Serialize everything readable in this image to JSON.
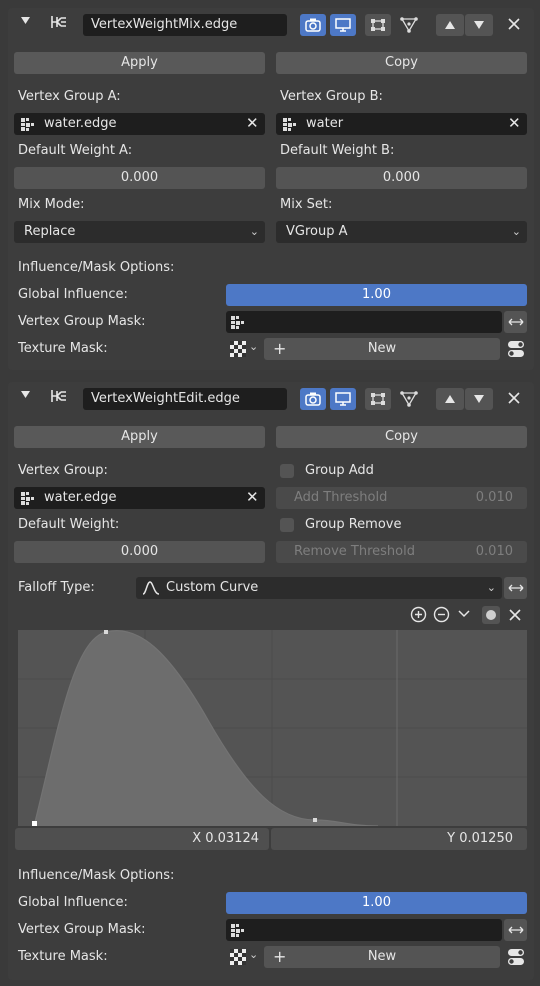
{
  "mix": {
    "name": "VertexWeightMix.edge",
    "apply": "Apply",
    "copy": "Copy",
    "vgroup_a_label": "Vertex Group A:",
    "vgroup_a_value": "water.edge",
    "vgroup_b_label": "Vertex Group B:",
    "vgroup_b_value": "water",
    "def_a_label": "Default Weight A:",
    "def_a_value": "0.000",
    "def_b_label": "Default Weight B:",
    "def_b_value": "0.000",
    "mix_mode_label": "Mix Mode:",
    "mix_mode_value": "Replace",
    "mix_set_label": "Mix Set:",
    "mix_set_value": "VGroup A",
    "influence_label": "Influence/Mask Options:",
    "global_influence_label": "Global Influence:",
    "global_influence_value": "1.00",
    "vgroup_mask_label": "Vertex Group Mask:",
    "texture_mask_label": "Texture Mask:",
    "new_label": "New"
  },
  "edit": {
    "name": "VertexWeightEdit.edge",
    "apply": "Apply",
    "copy": "Copy",
    "vgroup_label": "Vertex Group:",
    "vgroup_value": "water.edge",
    "group_add_label": "Group Add",
    "add_threshold_label": "Add Threshold",
    "add_threshold_value": "0.010",
    "def_weight_label": "Default Weight:",
    "def_weight_value": "0.000",
    "group_remove_label": "Group Remove",
    "remove_threshold_label": "Remove Threshold",
    "remove_threshold_value": "0.010",
    "falloff_label": "Falloff Type:",
    "falloff_value": "Custom Curve",
    "curve_x": "X 0.03124",
    "curve_y": "Y 0.01250",
    "influence_label": "Influence/Mask Options:",
    "global_influence_label": "Global Influence:",
    "global_influence_value": "1.00",
    "vgroup_mask_label": "Vertex Group Mask:",
    "texture_mask_label": "Texture Mask:",
    "new_label": "New"
  },
  "colors": {
    "accent": "#4d78c6",
    "panel": "#3d3d3d",
    "background": "#3a3a3a",
    "field": "#545454",
    "dark_field": "#1e1e1e",
    "curve_bg": "#545454",
    "curve_fill": "#6d6d6d"
  },
  "icons": {
    "collapse": "triangle-down-icon",
    "modifier": "vertex-weight-modifier-icon",
    "render": "camera-icon",
    "viewport": "monitor-icon",
    "editmode": "edit-mode-icon",
    "cage": "cage-icon",
    "move_up": "arrow-up-icon",
    "move_down": "arrow-down-icon",
    "remove": "close-icon",
    "vertex_group": "vertex-group-icon",
    "texture": "checker-texture-icon",
    "zoom_in": "zoom-in-icon",
    "zoom_out": "zoom-out-icon",
    "curve_tools": "chevron-down-icon",
    "clip": "dot-icon",
    "swap": "swap-icon",
    "falloff_curve": "curve-icon"
  }
}
